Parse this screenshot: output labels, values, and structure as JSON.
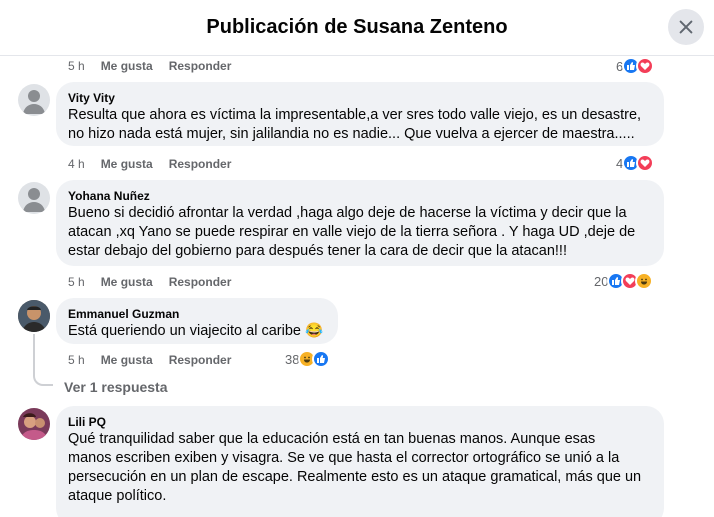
{
  "dialog": {
    "title": "Publicación de Susana Zenteno"
  },
  "comments": [
    {
      "author": "",
      "text": "",
      "time": "5 h",
      "like_label": "Me gusta",
      "reply_label": "Responder",
      "reaction_count": "6",
      "reactions": [
        "like-icon",
        "love-icon"
      ]
    },
    {
      "author": "Vity Vity",
      "text_lines": [
        "Resulta que ahora es víctima la impresentable,a ver sres todo valle viejo, es un desastre,",
        "no hizo nada está mujer, sin jalilandia no es nadie... Que vuelva a ejercer de maestra....."
      ],
      "time": "4 h",
      "like_label": "Me gusta",
      "reply_label": "Responder",
      "reaction_count": "4",
      "reactions": [
        "like-icon",
        "love-icon"
      ]
    },
    {
      "author": "Yohana Nuñez",
      "text_lines": [
        "Bueno si decidió afrontar la verdad ,haga algo deje de hacerse la víctima y decir que la",
        "atacan ,xq Yano se puede respirar en valle viejo de la tierra señora . Y haga UD ,deje de",
        "estar debajo del gobierno para después tener la cara de decir que la atacan!!!"
      ],
      "time": "5 h",
      "like_label": "Me gusta",
      "reply_label": "Responder",
      "reaction_count": "20",
      "reactions": [
        "like-icon",
        "love-icon",
        "haha-icon"
      ]
    },
    {
      "author": "Emmanuel Guzman",
      "text_lines": [
        "Está queriendo un viajecito al caribe 😂"
      ],
      "time": "5 h",
      "like_label": "Me gusta",
      "reply_label": "Responder",
      "reaction_count": "38",
      "reactions": [
        "haha-icon",
        "like-icon"
      ],
      "replies_label": "Ver 1 respuesta"
    },
    {
      "author": "Lili PQ",
      "text_lines": [
        "Qué tranquilidad saber que la educación está en tan buenas manos. Aunque esas",
        "manos escriben exiben y visagra. Se ve que hasta el corrector ortográfico se unió a la",
        "persecución en un plan de escape. Realmente esto es un ataque gramatical, más que un",
        "ataque político."
      ]
    }
  ],
  "colors": {
    "like": "#1877f2",
    "love": "#f33e58",
    "haha": "#f7b125",
    "bubble": "#f0f2f5",
    "meta": "#65676b"
  }
}
